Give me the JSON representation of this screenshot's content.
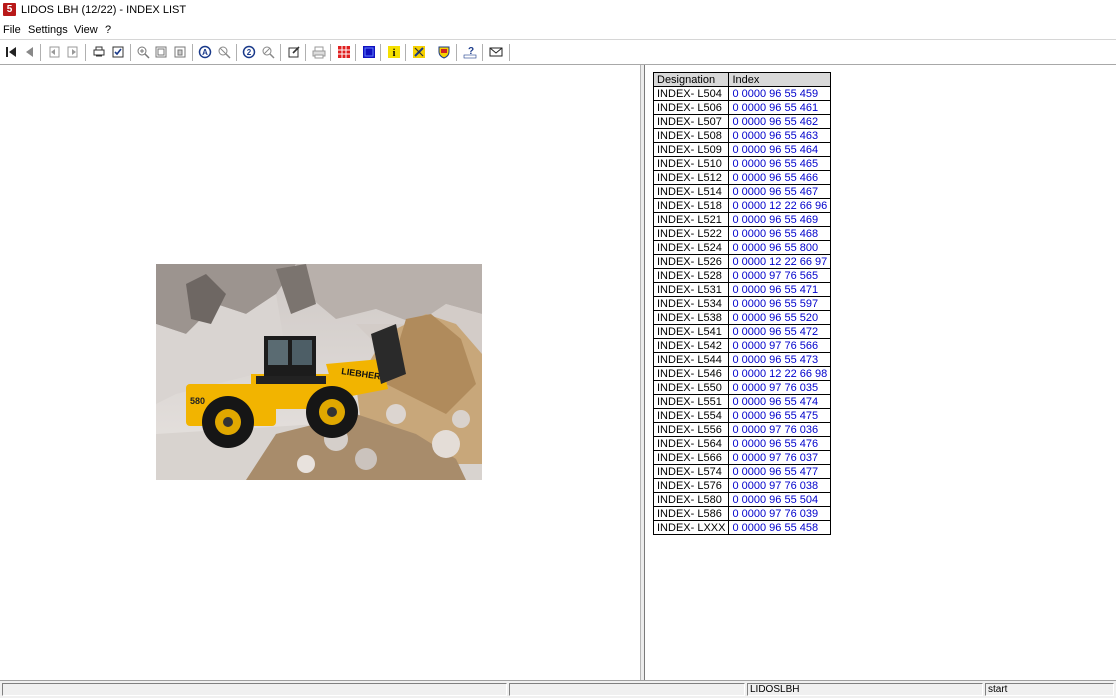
{
  "window": {
    "title": "LIDOS LBH (12/22) - INDEX LIST",
    "icon": "lidos-app-icon"
  },
  "menu": [
    "File",
    "Settings",
    "View",
    "?"
  ],
  "toolbar": {
    "icons": [
      "first-record-icon",
      "previous-record-icon",
      "back-page-icon",
      "forward-page-icon",
      "print-list-icon",
      "checklist-icon",
      "zoom-in-icon",
      "zoom-fit-icon",
      "zoom-page-icon",
      "search-a-icon",
      "search-clear-icon",
      "search-number-icon",
      "search-reset-icon",
      "edit-icon",
      "printer-icon",
      "grid-view-icon",
      "blue-square-icon",
      "info-icon",
      "tools-icon",
      "shield-icon",
      "help-icon",
      "mail-icon"
    ]
  },
  "table": {
    "headers": [
      "Designation",
      "Index"
    ],
    "rows": [
      [
        "INDEX- L504",
        "0 0000 96 55 459"
      ],
      [
        "INDEX- L506",
        "0 0000 96 55 461"
      ],
      [
        "INDEX- L507",
        "0 0000 96 55 462"
      ],
      [
        "INDEX- L508",
        "0 0000 96 55 463"
      ],
      [
        "INDEX- L509",
        "0 0000 96 55 464"
      ],
      [
        "INDEX- L510",
        "0 0000 96 55 465"
      ],
      [
        "INDEX- L512",
        "0 0000 96 55 466"
      ],
      [
        "INDEX- L514",
        "0 0000 96 55 467"
      ],
      [
        "INDEX- L518",
        "0 0000 12 22 66 96"
      ],
      [
        "INDEX- L521",
        "0 0000 96 55 469"
      ],
      [
        "INDEX- L522",
        "0 0000 96 55 468"
      ],
      [
        "INDEX- L524",
        "0 0000 96 55 800"
      ],
      [
        "INDEX- L526",
        "0 0000 12 22 66 97"
      ],
      [
        "INDEX- L528",
        "0 0000 97 76 565"
      ],
      [
        "INDEX- L531",
        "0 0000 96 55 471"
      ],
      [
        "INDEX- L534",
        "0 0000 96 55 597"
      ],
      [
        "INDEX- L538",
        "0 0000 96 55 520"
      ],
      [
        "INDEX- L541",
        "0 0000 96 55 472"
      ],
      [
        "INDEX- L542",
        "0 0000 97 76 566"
      ],
      [
        "INDEX- L544",
        "0 0000 96 55 473"
      ],
      [
        "INDEX- L546",
        "0 0000 12 22 66 98"
      ],
      [
        "INDEX- L550",
        "0 0000 97 76 035"
      ],
      [
        "INDEX- L551",
        "0 0000 96 55 474"
      ],
      [
        "INDEX- L554",
        "0 0000 96 55 475"
      ],
      [
        "INDEX- L556",
        "0 0000 97 76 036"
      ],
      [
        "INDEX- L564",
        "0 0000 96 55 476"
      ],
      [
        "INDEX- L566",
        "0 0000 97 76 037"
      ],
      [
        "INDEX- L574",
        "0 0000 96 55 477"
      ],
      [
        "INDEX- L576",
        "0 0000 97 76 038"
      ],
      [
        "INDEX- L580",
        "0 0000 96 55 504"
      ],
      [
        "INDEX- L586",
        "0 0000 97 76 039"
      ],
      [
        "INDEX- LXXX",
        "0 0000 96 55 458"
      ]
    ]
  },
  "image": {
    "machine_brand": "LIEBHERR",
    "machine_model_label": "580"
  },
  "statusbar": {
    "app_name": "LIDOSLBH",
    "start_label": "start"
  },
  "colors": {
    "link": "#0000cc",
    "loader_yellow": "#f2b400",
    "header_bg": "#d9d9d9"
  }
}
